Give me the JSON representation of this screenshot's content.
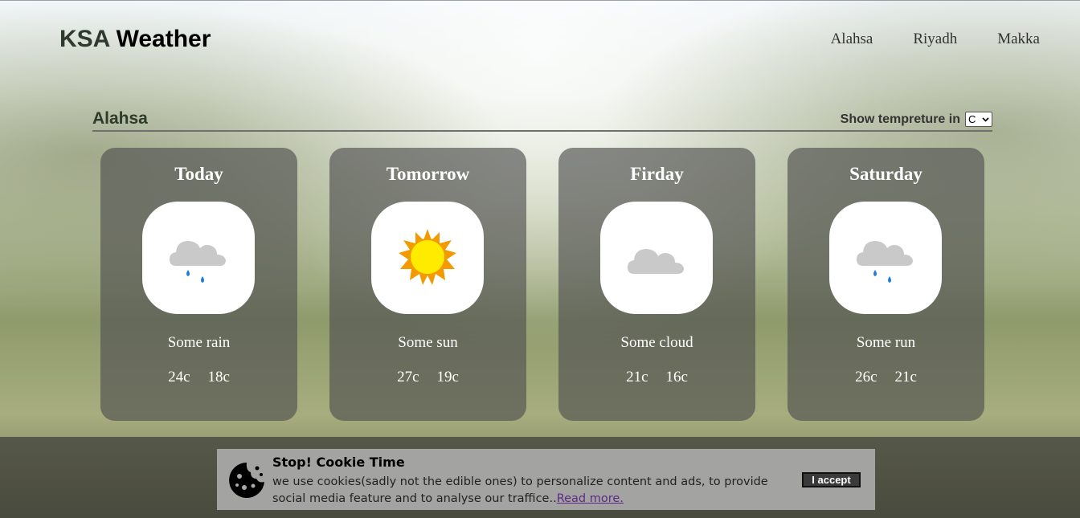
{
  "app": {
    "logo_part1": "KSA",
    "logo_part2": "Weather"
  },
  "nav": {
    "items": [
      "Alahsa",
      "Riyadh",
      "Makka"
    ]
  },
  "section": {
    "city": "Alahsa",
    "unit_label": "Show tempreture in",
    "unit_value": "C"
  },
  "forecast": [
    {
      "day": "Today",
      "icon": "rain-cloud-icon",
      "desc": "Some rain",
      "high": "24c",
      "low": "18c"
    },
    {
      "day": "Tomorrow",
      "icon": "sun-icon",
      "desc": "Some sun",
      "high": "27c",
      "low": "19c"
    },
    {
      "day": "Firday",
      "icon": "cloud-icon",
      "desc": "Some cloud",
      "high": "21c",
      "low": "16c"
    },
    {
      "day": "Saturday",
      "icon": "rain-cloud-icon",
      "desc": "Some run",
      "high": "26c",
      "low": "21c"
    }
  ],
  "cookie": {
    "title": "Stop! Cookie Time",
    "text": "we use cookies(sadly not the edible ones) to personalize content and ads, to provide social media feature and to analyse our traffice..",
    "link": "Read more.",
    "accept": "I accept"
  },
  "colors": {
    "card_bg": "#505050",
    "sun": "#ffeb00",
    "sun_rays": "#f29a00",
    "cloud": "#c9c9c9",
    "rain": "#1e7fd8"
  }
}
